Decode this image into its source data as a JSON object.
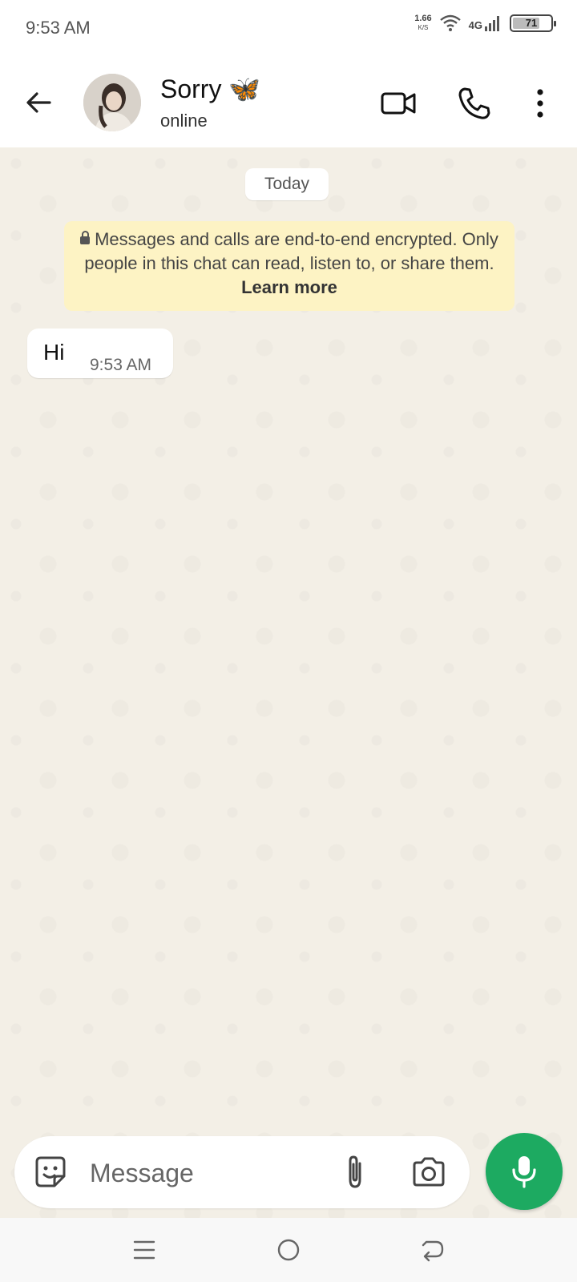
{
  "status_bar": {
    "time": "9:53 AM",
    "net_speed_value": "1.66",
    "net_speed_unit": "K/S",
    "network_type": "4G",
    "battery": "71",
    "battery_fraction": 0.71
  },
  "header": {
    "contact_name": "Sorry 🦋",
    "contact_status": "online"
  },
  "chat": {
    "day_label": "Today",
    "encryption_notice": "Messages and calls are end-to-end encrypted. Only people in this chat can read, listen to, or share them.",
    "learn_more": "Learn more",
    "messages": [
      {
        "text": "Hi",
        "time": "9:53 AM",
        "direction": "incoming"
      }
    ]
  },
  "composer": {
    "placeholder": "Message"
  },
  "colors": {
    "accent_green": "#1daa61",
    "notice_bg": "#fdf3c4",
    "chat_bg": "#f3efe6"
  },
  "icons": {
    "back": "arrow-left-icon",
    "video": "video-call-icon",
    "call": "phone-icon",
    "menu": "more-vert-icon",
    "sticker": "sticker-icon",
    "attach": "paperclip-icon",
    "camera": "camera-icon",
    "mic": "mic-icon"
  }
}
